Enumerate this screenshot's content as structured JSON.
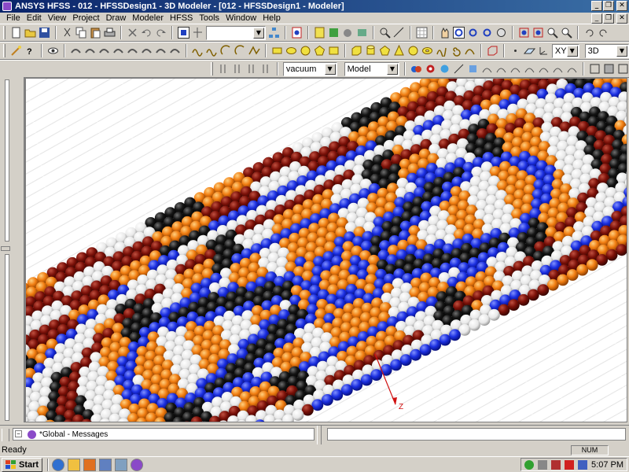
{
  "window": {
    "title": "ANSYS HFSS - 012 - HFSSDesign1 - 3D Modeler - [012 - HFSSDesign1 - Modeler]"
  },
  "menu": [
    "File",
    "Edit",
    "View",
    "Project",
    "Draw",
    "Modeler",
    "HFSS",
    "Tools",
    "Window",
    "Help"
  ],
  "toolbar": {
    "plane_select": "XY",
    "view_select": "3D",
    "material_select": "vacuum",
    "model_select": "Model",
    "blank_combo": ""
  },
  "viewport": {
    "axis_label": "Z"
  },
  "messages": {
    "tab_label": "*Global - Messages"
  },
  "status": {
    "text": "Ready",
    "num_indicator": "NUM"
  },
  "taskbar": {
    "start_label": "Start",
    "clock": "5:07 PM"
  },
  "colors": {
    "bead_blue": "#1a2ee0",
    "bead_orange": "#f07c10",
    "bead_maroon": "#7a1008",
    "bead_black": "#101010",
    "bead_white": "#f0f0f0"
  }
}
